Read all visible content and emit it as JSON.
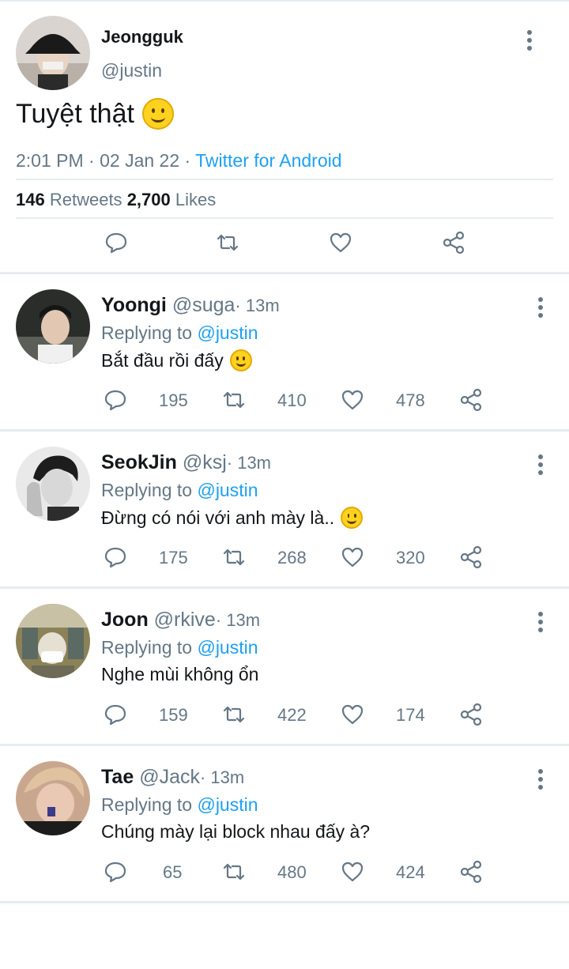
{
  "main_tweet": {
    "name": "Jeongguk",
    "handle": "@justin",
    "text": "Tuyệt thật",
    "meta_time": "2:01 PM · 02 Jan 22 · ",
    "meta_source": "Twitter for Android",
    "retweets_count": "146",
    "retweets_label": "Retweets",
    "likes_count": "2,700",
    "likes_label": "Likes"
  },
  "replies": [
    {
      "name": "Yoongi",
      "handle": "@suga",
      "time": "· 13m",
      "replying_label": "Replying to",
      "replying_to": "@justin",
      "text": "Bắt đầu rồi đấy",
      "emoji": true,
      "replies": "195",
      "retweets": "410",
      "likes": "478"
    },
    {
      "name": "SeokJin",
      "handle": "@ksj",
      "time": "· 13m",
      "replying_label": "Replying to",
      "replying_to": "@justin",
      "text": "Đừng có nói với anh mày là..",
      "emoji": true,
      "replies": "175",
      "retweets": "268",
      "likes": "320"
    },
    {
      "name": "Joon",
      "handle": "@rkive",
      "time": "· 13m",
      "replying_label": "Replying to",
      "replying_to": "@justin",
      "text": "Nghe mùi không ổn",
      "emoji": false,
      "replies": "159",
      "retweets": "422",
      "likes": "174"
    },
    {
      "name": "Tae",
      "handle": "@Jack",
      "time": "· 13m",
      "replying_label": "Replying to",
      "replying_to": "@justin",
      "text": "Chúng mày lại block nhau đấy à?",
      "emoji": false,
      "replies": "65",
      "retweets": "480",
      "likes": "424"
    }
  ],
  "icons": [
    "more-vertical-icon",
    "reply-icon",
    "retweet-icon",
    "like-icon",
    "share-icon",
    "smile-emoji-icon"
  ],
  "colors": {
    "accent": "#1da1f2",
    "secondary_text": "#657786",
    "divider": "#e6ecf0"
  }
}
